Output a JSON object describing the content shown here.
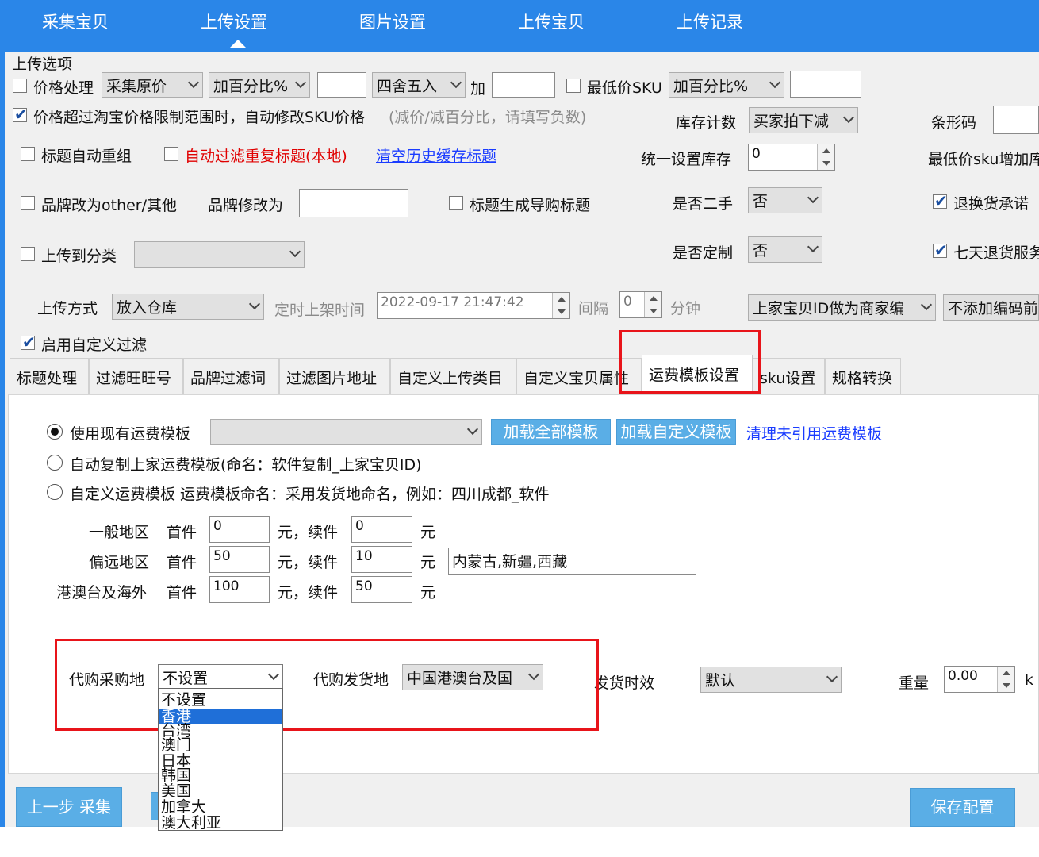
{
  "nav": {
    "items": [
      {
        "label": "采集宝贝",
        "active": false
      },
      {
        "label": "上传设置",
        "active": true
      },
      {
        "label": "图片设置",
        "active": false
      },
      {
        "label": "上传宝贝",
        "active": false
      },
      {
        "label": "上传记录",
        "active": false
      }
    ]
  },
  "group_title": "上传选项",
  "price": {
    "checkbox_label": "价格处理",
    "checked": false,
    "source": "采集原价",
    "mode": "加百分比%",
    "value": "",
    "rounding": "四舍五入",
    "add_label": "加",
    "add_value": "",
    "min_sku_label": "最低价SKU",
    "min_sku_checked": false,
    "min_sku_mode": "加百分比%",
    "min_sku_value": ""
  },
  "auto_fix": {
    "label": "价格超过淘宝价格限制范围时，自动修改SKU价格",
    "checked": true,
    "hint": "(减价/减百分比，请填写负数)"
  },
  "stock": {
    "count_label": "库存计数",
    "count_value": "买家拍下减",
    "barcode_label": "条形码",
    "barcode_value": "",
    "unified_label": "统一设置库存",
    "unified_value": "0",
    "min_sku_add_label": "最低价sku增加库"
  },
  "title": {
    "regroup_label": "标题自动重组",
    "regroup_checked": false,
    "filter_dup_label": "自动过滤重复标题(本地)",
    "filter_dup_checked": false,
    "clear_cache_link": "清空历史缓存标题",
    "guide_label": "标题生成导购标题",
    "guide_checked": false
  },
  "brand": {
    "other_label": "品牌改为other/其他",
    "other_checked": false,
    "change_label": "品牌修改为",
    "change_value": ""
  },
  "second_hand": {
    "label": "是否二手",
    "value": "否"
  },
  "return_promise": {
    "label": "退换货承诺",
    "checked": true
  },
  "category": {
    "label": "上传到分类",
    "checked": false,
    "value": ""
  },
  "custom_made": {
    "label": "是否定制",
    "value": "否"
  },
  "seven_day": {
    "label": "七天退货服务",
    "checked": true
  },
  "upload_mode": {
    "label": "上传方式",
    "value": "放入仓库",
    "timer_label": "定时上架时间",
    "timer_value": "2022-09-17 21:47:42",
    "interval_label": "间隔",
    "interval_value": "0",
    "minutes_label": "分钟",
    "merchant_code": "上家宝贝ID做为商家编",
    "code_suffix": "不添加编码前缀"
  },
  "custom_filter": {
    "label": "启用自定义过滤",
    "checked": true
  },
  "tabs": [
    {
      "label": "标题处理",
      "active": false
    },
    {
      "label": "过滤旺旺号",
      "active": false
    },
    {
      "label": "品牌过滤词",
      "active": false
    },
    {
      "label": "过滤图片地址",
      "active": false
    },
    {
      "label": "自定义上传类目",
      "active": false
    },
    {
      "label": "自定义宝贝属性",
      "active": false
    },
    {
      "label": "运费模板设置",
      "active": true
    },
    {
      "label": "sku设置",
      "active": false
    },
    {
      "label": "规格转换",
      "active": false
    }
  ],
  "freight": {
    "opt_existing": "使用现有运费模板",
    "existing_value": "",
    "btn_load_all": "加载全部模板",
    "btn_load_custom": "加载自定义模板",
    "link_clean": "清理未引用运费模板",
    "opt_copy": "自动复制上家运费模板(命名：软件复制_上家宝贝ID)",
    "opt_custom": "自定义运费模板 运费模板命名：采用发货地命名，例如：四川成都_软件",
    "selected": "existing",
    "first_label": "首件",
    "yuan_cont": "元，续件",
    "yuan": "元",
    "regions": [
      {
        "name": "一般地区",
        "first": "0",
        "cont": "0",
        "extra": null
      },
      {
        "name": "偏远地区",
        "first": "50",
        "cont": "10",
        "extra": "内蒙古,新疆,西藏"
      },
      {
        "name": "港澳台及海外",
        "first": "100",
        "cont": "50",
        "extra": null
      }
    ]
  },
  "purchase": {
    "place_label": "代购采购地",
    "place_value": "不设置",
    "ship_label": "代购发货地",
    "ship_value": "中国港澳台及国",
    "time_label": "发货时效",
    "time_value": "默认",
    "weight_label": "重量",
    "weight_value": "0.00",
    "weight_unit": "k",
    "dropdown_options": [
      "不设置",
      "香港",
      "台湾",
      "澳门",
      "日本",
      "韩国",
      "美国",
      "加拿大",
      "澳大利亚"
    ],
    "dropdown_highlight": 1
  },
  "footer": {
    "prev_btn": "上一步 采集",
    "save_btn": "保存配置"
  },
  "colors": {
    "accent": "#2a86e8",
    "button": "#5aaee6",
    "highlight_box": "#e8141a"
  }
}
